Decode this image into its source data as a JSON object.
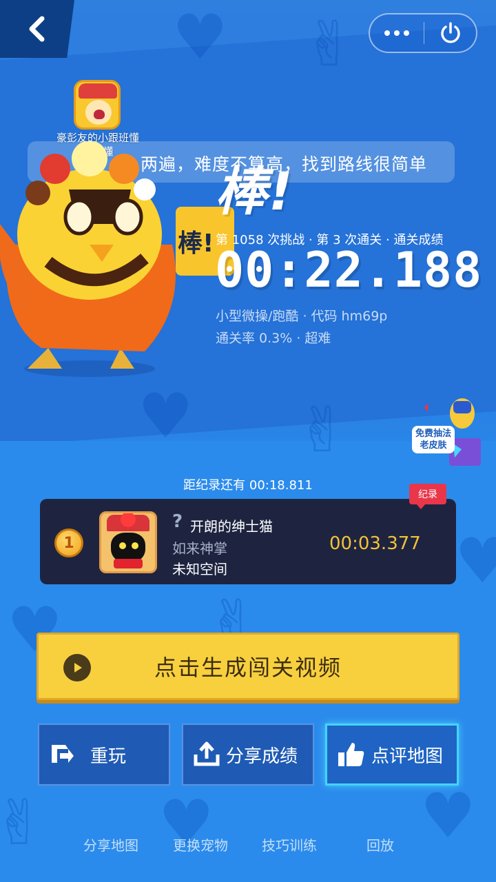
{
  "nav": {
    "back_icon": "chevron-left-icon",
    "more_icon": "more-dots-icon",
    "close_icon": "power-icon"
  },
  "commenter": {
    "name": "豪彭友的小跟班懂的都懂"
  },
  "comment": {
    "text": "两遍，难度不算高，找到路线很简单"
  },
  "result": {
    "headline": "棒!",
    "mascot_sign": "棒!",
    "attempt_line": "第 1058 次挑战 · 第 3 次通关 · 通关成绩",
    "time": "00:22.188",
    "map_info": "小型微操/跑酷 · 代码 hm69p",
    "rate_info": "通关率 0.3% · 超难"
  },
  "promo": {
    "label": "免费抽法老皮肤"
  },
  "record": {
    "gap_text": "距纪录还有 00:18.811",
    "tag": "纪录",
    "rank": "1",
    "player_name": "开朗的绅士猫",
    "player_title": "如来神掌",
    "player_place": "未知空间",
    "time": "00:03.377"
  },
  "actions": {
    "video_label": "点击生成闯关视频",
    "replay_label": "重玩",
    "share_label": "分享成绩",
    "rate_label": "点评地图"
  },
  "bottom_links": [
    "分享地图",
    "更换宠物",
    "技巧训练",
    "回放"
  ],
  "colors": {
    "background": "#2a86e8",
    "button_yellow": "#f8d03e",
    "record_card": "#1e2440",
    "record_time": "#f3c237",
    "record_tag": "#e9364a",
    "highlight_border": "#43d4ff"
  }
}
